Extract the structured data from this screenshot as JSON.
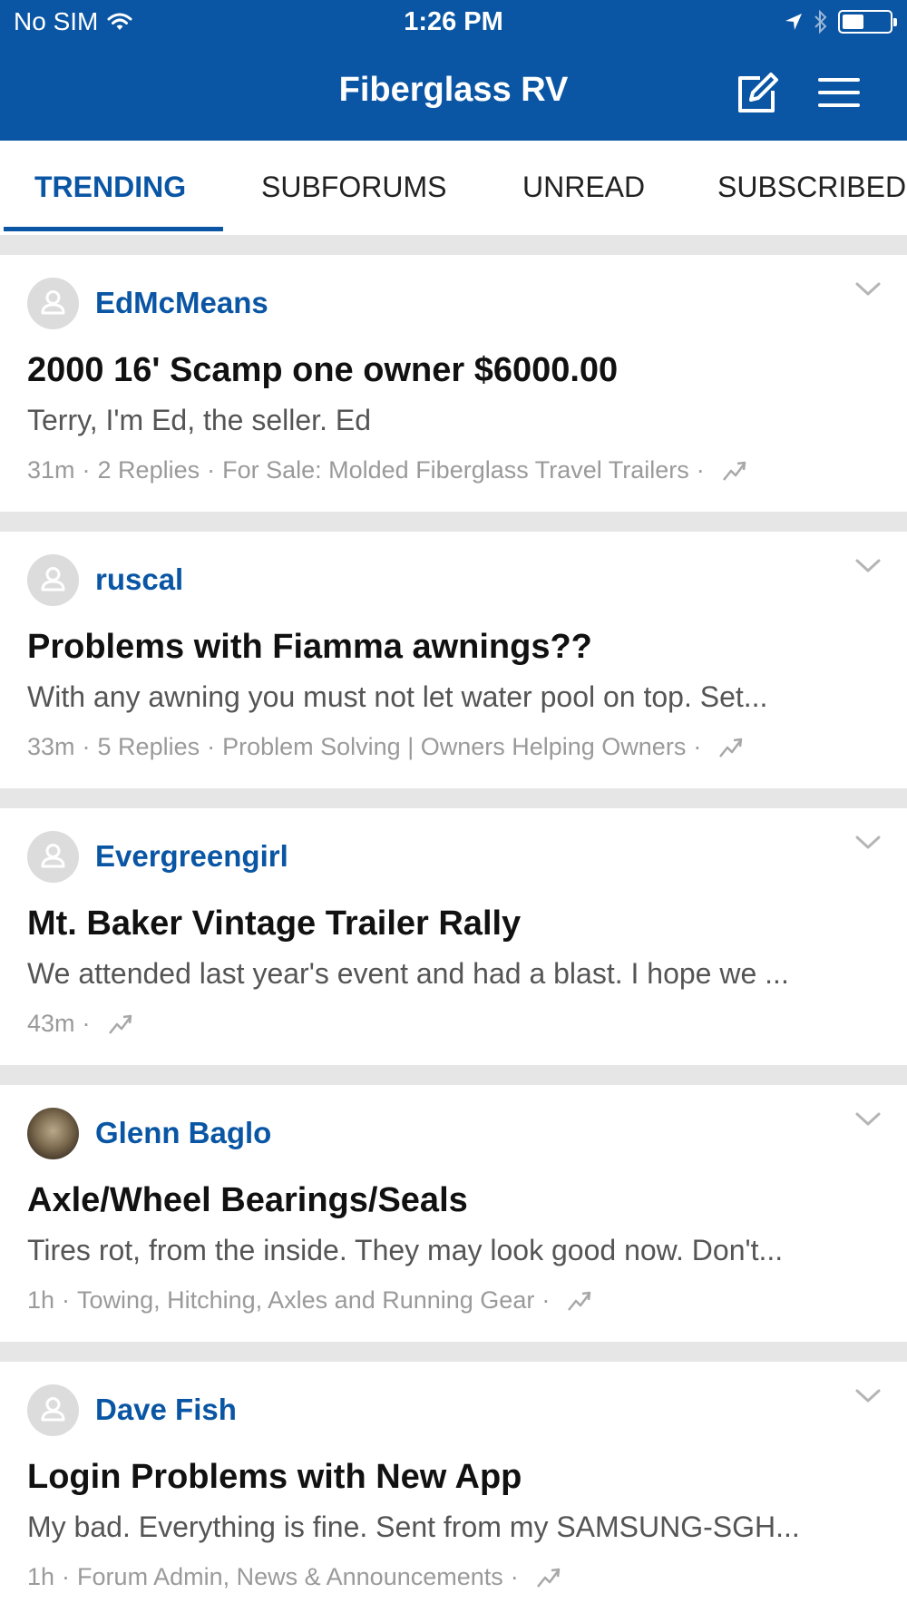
{
  "status_bar": {
    "carrier": "No SIM",
    "time": "1:26 PM"
  },
  "nav": {
    "title": "Fiberglass RV"
  },
  "tabs": [
    {
      "label": "TRENDING",
      "active": true
    },
    {
      "label": "SUBFORUMS",
      "active": false
    },
    {
      "label": "UNREAD",
      "active": false
    },
    {
      "label": "SUBSCRIBED",
      "active": false
    }
  ],
  "posts": [
    {
      "author": "EdMcMeans",
      "title": "2000 16' Scamp one owner $6000.00",
      "snippet": "Terry, I'm Ed, the seller. Ed",
      "time": "31m",
      "replies": "2 Replies",
      "forum": "For Sale:  Molded Fiberglass Travel Trailers"
    },
    {
      "author": "ruscal",
      "title": "Problems with Fiamma awnings??",
      "snippet": "With any awning you must not let water pool on top. Set...",
      "time": "33m",
      "replies": "5 Replies",
      "forum": "Problem Solving |  Owners Helping Owners"
    },
    {
      "author": "Evergreengirl",
      "title": "Mt. Baker Vintage Trailer Rally",
      "snippet": "We attended last year's event and had a blast. I hope we ...",
      "time": "43m"
    },
    {
      "author": "Glenn Baglo",
      "title": "Axle/Wheel Bearings/Seals",
      "snippet": "Tires rot, from the inside. They may look good now. Don't...",
      "time": "1h",
      "forum": "Towing, Hitching, Axles and Running Gear"
    },
    {
      "author": "Dave Fish",
      "title": "Login Problems with New App",
      "snippet": "My bad. Everything is fine. Sent from my SAMSUNG-SGH...",
      "time": "1h",
      "forum": "Forum Admin, News & Announcements"
    }
  ],
  "icons": {
    "wifi": "wifi-icon",
    "location": "location-arrow-icon",
    "bluetooth": "bluetooth-icon",
    "battery": "battery-icon",
    "compose": "compose-icon",
    "menu": "hamburger-menu-icon",
    "chevron": "chevron-down-icon",
    "trend": "trending-icon",
    "avatar": "user-avatar-icon"
  },
  "status": {
    "battery_level": 0.45
  },
  "colors": {
    "primary": "#0a56a4",
    "divider": "#e6e6e6",
    "meta_text": "#9a9a9a"
  }
}
